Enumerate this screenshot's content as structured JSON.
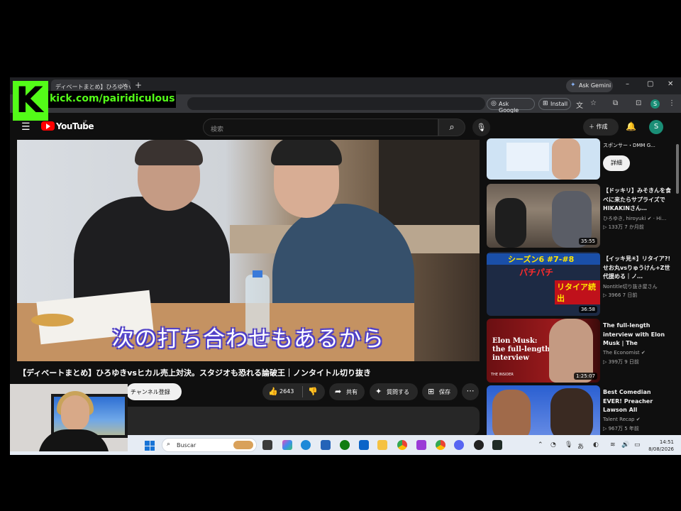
{
  "browser": {
    "tab_title": "ディベートまとめ】ひろゆきvsヒカル",
    "tab_close": "×",
    "new_tab": "+",
    "gemini_label": "Ask Gemini",
    "ask_google_label": "Ask Google",
    "install_label": "Install",
    "profile_initial": "S",
    "window_controls": [
      "–",
      "▢",
      "✕"
    ]
  },
  "overlay": {
    "kick_letter": "K",
    "kick_url": "kick.com/pairidiculous"
  },
  "youtube": {
    "logo_text": "YouTube",
    "logo_region": "JP",
    "search_placeholder": "検索",
    "create_label": "作成",
    "avatar_initial": "S"
  },
  "video": {
    "subtitle": "次の打ち合わせもあるから",
    "title": "【ディベートまとめ】ひろゆきvsヒカル売上対決。スタジオも恐れる論破王｜ノンタイトル切り抜き",
    "subscribe_label": "チャンネル登録",
    "like_count": "2643",
    "share_label": "共有",
    "ask_label": "質問する",
    "save_label": "保存"
  },
  "sidebar": {
    "sponsor_text": "スポンサー・DMM G...",
    "details_label": "詳細",
    "items": [
      {
        "title": "【ドッキリ】みそきんを食べに来たらサプライズでHIKAKINさん…",
        "channel": "ひろゆき, hiroyuki ✔ · Hi…",
        "meta": "▷ 133万 7 か月前",
        "duration": "35:55"
      },
      {
        "title": "【イッキ見④】リタイア?! せお丸vsりゅうけん+Z世代援める｜ノ…",
        "channel": "Nontitle切り抜き屋さん",
        "meta": "▷ 3966 7 日前",
        "duration": "36:58"
      },
      {
        "title": "The full-length interview with Elon Musk | The Economist",
        "channel": "The Economist ✔",
        "meta": "▷ 399万 9 日前",
        "duration": "1:25:07"
      },
      {
        "title": "Best Comedian EVER! Preacher Lawson All Performances on…",
        "channel": "Talent Recap ✔",
        "meta": "▷ 967万 5 年前",
        "duration": ""
      }
    ],
    "thumb_texts": {
      "economist_line1": "Elon Musk:",
      "economist_line2": "the full-length",
      "economist_line3": "interview",
      "insider": "THE INSIDER",
      "nontitle_banner": "シーズン6 #7-#8",
      "nontitle_red": "パチパチ",
      "nontitle_retire": "リタイア続出"
    }
  },
  "taskbar": {
    "search_label": "Buscar",
    "time": "14:51",
    "date": "8/08/2026",
    "ime": "あ"
  },
  "colors": {
    "kick_green": "#53fc18",
    "youtube_red": "#ff0000",
    "dark_bg": "#0f0f0f"
  }
}
